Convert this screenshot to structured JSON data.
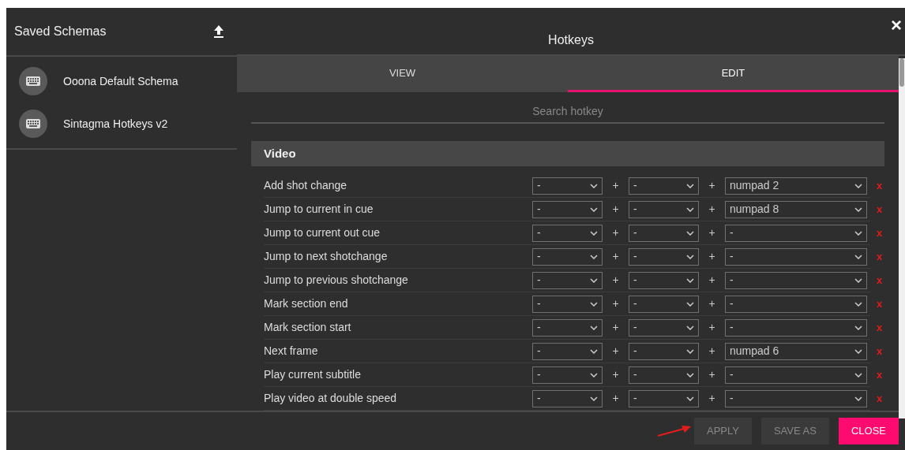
{
  "sidebar": {
    "title": "Saved Schemas",
    "items": [
      {
        "label": "Ooona Default Schema"
      },
      {
        "label": "Sintagma Hotkeys v2"
      }
    ]
  },
  "dialog": {
    "title": "Hotkeys",
    "close_glyph": "×"
  },
  "tabs": [
    {
      "label": "VIEW",
      "selected": false
    },
    {
      "label": "EDIT",
      "selected": true
    }
  ],
  "search": {
    "placeholder": "Search hotkey"
  },
  "section": {
    "title": "Video"
  },
  "hotkeys": [
    {
      "label": "Add shot change",
      "keys": [
        "-",
        "-",
        "numpad 2"
      ],
      "plus": [
        "+",
        "+"
      ],
      "remove": "x"
    },
    {
      "label": "Jump to current in cue",
      "keys": [
        "-",
        "-",
        "numpad 8"
      ],
      "plus": [
        "+",
        "+"
      ],
      "remove": "x"
    },
    {
      "label": "Jump to current out cue",
      "keys": [
        "-",
        "-",
        "-"
      ],
      "plus": [
        "+",
        "+"
      ],
      "remove": "x"
    },
    {
      "label": "Jump to next shotchange",
      "keys": [
        "-",
        "-",
        "-"
      ],
      "plus": [
        "+",
        "+"
      ],
      "remove": "x"
    },
    {
      "label": "Jump to previous shotchange",
      "keys": [
        "-",
        "-",
        "-"
      ],
      "plus": [
        "+",
        "+"
      ],
      "remove": "x"
    },
    {
      "label": "Mark section end",
      "keys": [
        "-",
        "-",
        "-"
      ],
      "plus": [
        "+",
        "+"
      ],
      "remove": "x"
    },
    {
      "label": "Mark section start",
      "keys": [
        "-",
        "-",
        "-"
      ],
      "plus": [
        "+",
        "+"
      ],
      "remove": "x"
    },
    {
      "label": "Next frame",
      "keys": [
        "-",
        "-",
        "numpad 6"
      ],
      "plus": [
        "+",
        "+"
      ],
      "remove": "x"
    },
    {
      "label": "Play current subtitle",
      "keys": [
        "-",
        "-",
        "-"
      ],
      "plus": [
        "+",
        "+"
      ],
      "remove": "x"
    },
    {
      "label": "Play video at double speed",
      "keys": [
        "-",
        "-",
        "-"
      ],
      "plus": [
        "+",
        "+"
      ],
      "remove": "x"
    }
  ],
  "buttons": [
    {
      "label": "APPLY",
      "kind": "plain"
    },
    {
      "label": "SAVE AS",
      "kind": "plain"
    },
    {
      "label": "CLOSE",
      "kind": "primary"
    }
  ]
}
